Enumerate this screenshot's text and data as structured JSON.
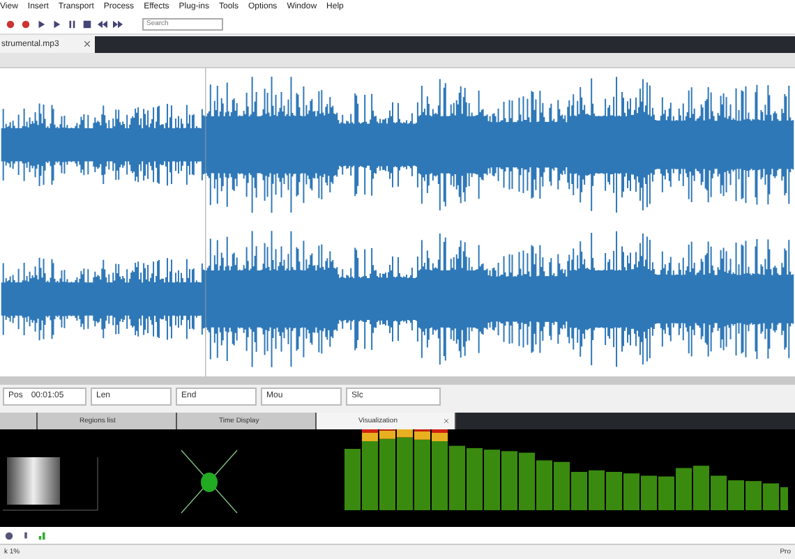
{
  "menu": [
    "View",
    "Insert",
    "Transport",
    "Process",
    "Effects",
    "Plug-ins",
    "Tools",
    "Options",
    "Window",
    "Help"
  ],
  "search": {
    "placeholder": "Search"
  },
  "document_tab": {
    "label": "strumental.mp3"
  },
  "position_bar": {
    "fields": [
      {
        "label": "Pos",
        "value": "00:01:05"
      },
      {
        "label": "Len"
      },
      {
        "label": "End"
      },
      {
        "label": "Mou"
      },
      {
        "label": "Slc"
      }
    ]
  },
  "panel_tabs": [
    {
      "selected": false
    },
    {
      "label": "Regions list",
      "selected": false
    },
    {
      "label": "Time Display",
      "selected": false
    },
    {
      "label": "Visualization",
      "selected": true
    }
  ],
  "status_bar": {
    "left": "k 1%",
    "right": "Pro"
  }
}
